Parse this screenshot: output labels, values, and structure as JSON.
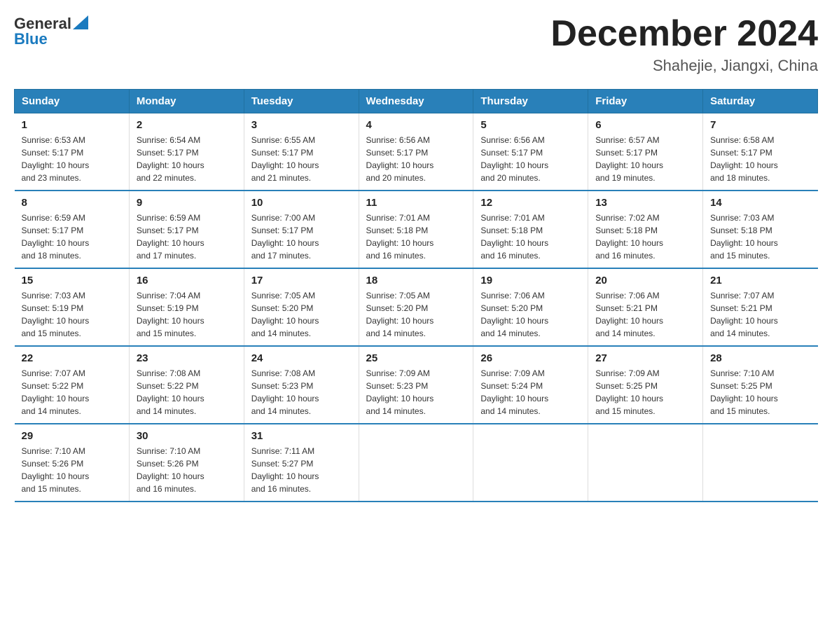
{
  "logo": {
    "general": "General",
    "blue": "Blue"
  },
  "title": "December 2024",
  "subtitle": "Shahejie, Jiangxi, China",
  "days_header": [
    "Sunday",
    "Monday",
    "Tuesday",
    "Wednesday",
    "Thursday",
    "Friday",
    "Saturday"
  ],
  "weeks": [
    [
      {
        "num": "1",
        "sunrise": "6:53 AM",
        "sunset": "5:17 PM",
        "daylight": "10 hours and 23 minutes."
      },
      {
        "num": "2",
        "sunrise": "6:54 AM",
        "sunset": "5:17 PM",
        "daylight": "10 hours and 22 minutes."
      },
      {
        "num": "3",
        "sunrise": "6:55 AM",
        "sunset": "5:17 PM",
        "daylight": "10 hours and 21 minutes."
      },
      {
        "num": "4",
        "sunrise": "6:56 AM",
        "sunset": "5:17 PM",
        "daylight": "10 hours and 20 minutes."
      },
      {
        "num": "5",
        "sunrise": "6:56 AM",
        "sunset": "5:17 PM",
        "daylight": "10 hours and 20 minutes."
      },
      {
        "num": "6",
        "sunrise": "6:57 AM",
        "sunset": "5:17 PM",
        "daylight": "10 hours and 19 minutes."
      },
      {
        "num": "7",
        "sunrise": "6:58 AM",
        "sunset": "5:17 PM",
        "daylight": "10 hours and 18 minutes."
      }
    ],
    [
      {
        "num": "8",
        "sunrise": "6:59 AM",
        "sunset": "5:17 PM",
        "daylight": "10 hours and 18 minutes."
      },
      {
        "num": "9",
        "sunrise": "6:59 AM",
        "sunset": "5:17 PM",
        "daylight": "10 hours and 17 minutes."
      },
      {
        "num": "10",
        "sunrise": "7:00 AM",
        "sunset": "5:17 PM",
        "daylight": "10 hours and 17 minutes."
      },
      {
        "num": "11",
        "sunrise": "7:01 AM",
        "sunset": "5:18 PM",
        "daylight": "10 hours and 16 minutes."
      },
      {
        "num": "12",
        "sunrise": "7:01 AM",
        "sunset": "5:18 PM",
        "daylight": "10 hours and 16 minutes."
      },
      {
        "num": "13",
        "sunrise": "7:02 AM",
        "sunset": "5:18 PM",
        "daylight": "10 hours and 16 minutes."
      },
      {
        "num": "14",
        "sunrise": "7:03 AM",
        "sunset": "5:18 PM",
        "daylight": "10 hours and 15 minutes."
      }
    ],
    [
      {
        "num": "15",
        "sunrise": "7:03 AM",
        "sunset": "5:19 PM",
        "daylight": "10 hours and 15 minutes."
      },
      {
        "num": "16",
        "sunrise": "7:04 AM",
        "sunset": "5:19 PM",
        "daylight": "10 hours and 15 minutes."
      },
      {
        "num": "17",
        "sunrise": "7:05 AM",
        "sunset": "5:20 PM",
        "daylight": "10 hours and 14 minutes."
      },
      {
        "num": "18",
        "sunrise": "7:05 AM",
        "sunset": "5:20 PM",
        "daylight": "10 hours and 14 minutes."
      },
      {
        "num": "19",
        "sunrise": "7:06 AM",
        "sunset": "5:20 PM",
        "daylight": "10 hours and 14 minutes."
      },
      {
        "num": "20",
        "sunrise": "7:06 AM",
        "sunset": "5:21 PM",
        "daylight": "10 hours and 14 minutes."
      },
      {
        "num": "21",
        "sunrise": "7:07 AM",
        "sunset": "5:21 PM",
        "daylight": "10 hours and 14 minutes."
      }
    ],
    [
      {
        "num": "22",
        "sunrise": "7:07 AM",
        "sunset": "5:22 PM",
        "daylight": "10 hours and 14 minutes."
      },
      {
        "num": "23",
        "sunrise": "7:08 AM",
        "sunset": "5:22 PM",
        "daylight": "10 hours and 14 minutes."
      },
      {
        "num": "24",
        "sunrise": "7:08 AM",
        "sunset": "5:23 PM",
        "daylight": "10 hours and 14 minutes."
      },
      {
        "num": "25",
        "sunrise": "7:09 AM",
        "sunset": "5:23 PM",
        "daylight": "10 hours and 14 minutes."
      },
      {
        "num": "26",
        "sunrise": "7:09 AM",
        "sunset": "5:24 PM",
        "daylight": "10 hours and 14 minutes."
      },
      {
        "num": "27",
        "sunrise": "7:09 AM",
        "sunset": "5:25 PM",
        "daylight": "10 hours and 15 minutes."
      },
      {
        "num": "28",
        "sunrise": "7:10 AM",
        "sunset": "5:25 PM",
        "daylight": "10 hours and 15 minutes."
      }
    ],
    [
      {
        "num": "29",
        "sunrise": "7:10 AM",
        "sunset": "5:26 PM",
        "daylight": "10 hours and 15 minutes."
      },
      {
        "num": "30",
        "sunrise": "7:10 AM",
        "sunset": "5:26 PM",
        "daylight": "10 hours and 16 minutes."
      },
      {
        "num": "31",
        "sunrise": "7:11 AM",
        "sunset": "5:27 PM",
        "daylight": "10 hours and 16 minutes."
      },
      {
        "num": "",
        "sunrise": "",
        "sunset": "",
        "daylight": ""
      },
      {
        "num": "",
        "sunrise": "",
        "sunset": "",
        "daylight": ""
      },
      {
        "num": "",
        "sunrise": "",
        "sunset": "",
        "daylight": ""
      },
      {
        "num": "",
        "sunrise": "",
        "sunset": "",
        "daylight": ""
      }
    ]
  ],
  "labels": {
    "sunrise": "Sunrise:",
    "sunset": "Sunset:",
    "daylight": "Daylight:"
  }
}
